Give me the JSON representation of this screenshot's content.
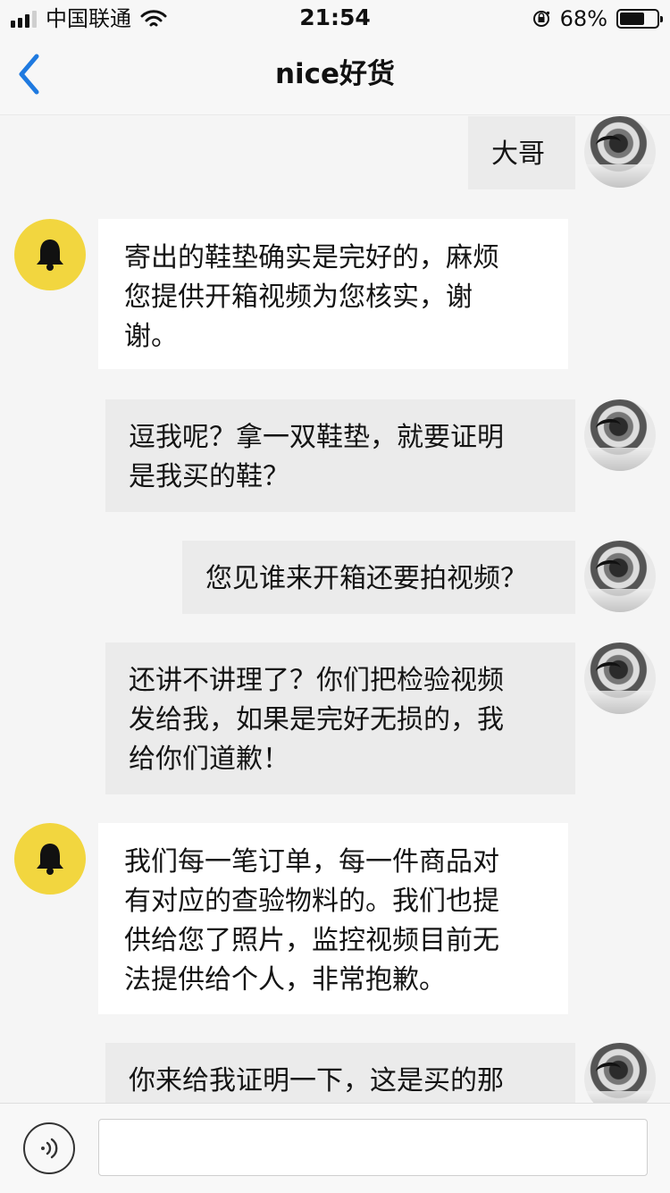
{
  "status_bar": {
    "carrier": "中国联通",
    "time": "21:54",
    "battery_percent": "68%",
    "battery_level": 0.68,
    "signal_bars": 3
  },
  "nav": {
    "title": "nice好货",
    "back_icon": "chevron-left-icon"
  },
  "colors": {
    "accent_blue": "#1f7ae0",
    "bot_avatar": "#f2d63f",
    "user_bubble": "#ebebeb",
    "bot_bubble": "#ffffff"
  },
  "messages": [
    {
      "sender": "user",
      "text": "大哥"
    },
    {
      "sender": "bot",
      "text": "寄出的鞋垫确实是完好的，麻烦\n您提供开箱视频为您核实，谢\n谢。"
    },
    {
      "sender": "user",
      "text": "逗我呢？拿一双鞋垫，就要证明\n是我买的鞋？"
    },
    {
      "sender": "user",
      "text": "您见谁来开箱还要拍视频？"
    },
    {
      "sender": "user",
      "text": "还讲不讲理了？你们把检验视频\n发给我，如果是完好无损的，我\n给你们道歉！"
    },
    {
      "sender": "bot",
      "text": "我们每一笔订单，每一件商品对\n有对应的查验物料的。我们也提\n供给您了照片，监控视频目前无\n法提供给个人，非常抱歉。"
    },
    {
      "sender": "user",
      "text": "你来给我证明一下，这是买的那"
    }
  ],
  "composer": {
    "voice_icon": "voice-icon",
    "input_value": "",
    "input_placeholder": ""
  }
}
